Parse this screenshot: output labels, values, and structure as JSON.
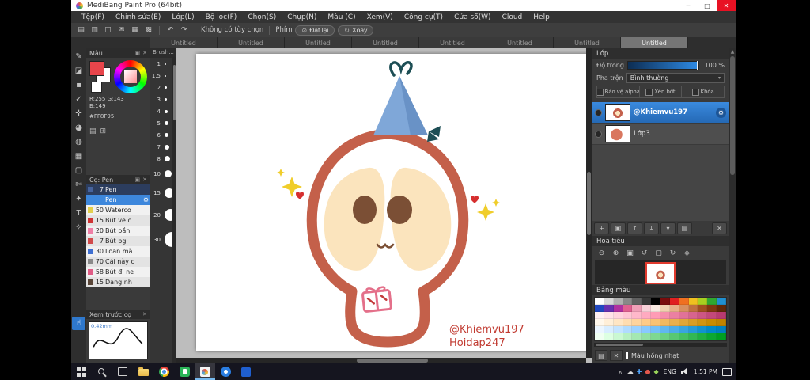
{
  "icons": {
    "gear": "⚙",
    "pin": "▣",
    "close": "✕",
    "caret_down": "▾",
    "scroll_up": "▲"
  },
  "window": {
    "title": "MediBang Paint Pro (64bit)",
    "controls": {
      "minimize": "─",
      "maximize": "□",
      "close": "✕"
    }
  },
  "menu": {
    "items": [
      "Tệp(F)",
      "Chỉnh sửa(E)",
      "Lớp(L)",
      "Bộ lọc(F)",
      "Chọn(S)",
      "Chụp(N)",
      "Màu (C)",
      "Xem(V)",
      "Công cụ(T)",
      "Cửa sổ(W)",
      "Cloud",
      "Help"
    ]
  },
  "toolbar": {
    "icons": [
      {
        "name": "new-canvas-icon",
        "glyph": "▤"
      },
      {
        "name": "open-file-icon",
        "glyph": "▥"
      },
      {
        "name": "save-icon",
        "glyph": "◫"
      },
      {
        "name": "export-icon",
        "glyph": "✉"
      },
      {
        "name": "grid-view-icon",
        "glyph": "▦"
      },
      {
        "name": "snap-settings-icon",
        "glyph": "▩"
      }
    ],
    "undo": "↶",
    "redo": "↷",
    "no_option_label": "Không có tùy chọn",
    "key_label": "Phím",
    "reset_icon": "⊘",
    "reset_button": "Đặt lại",
    "rotate_icon": "↻",
    "rotate_button": "Xoay"
  },
  "tabs": {
    "items": [
      "Untitled",
      "Untitled",
      "Untitled",
      "Untitled",
      "Untitled",
      "Untitled",
      "Untitled",
      "Untitled"
    ],
    "active_index": 7
  },
  "tools": [
    {
      "name": "brush-tool",
      "glyph": "✎"
    },
    {
      "name": "eraser-tool",
      "glyph": "◪"
    },
    {
      "name": "pen-tool",
      "glyph": "▪"
    },
    {
      "name": "smudge-tool",
      "glyph": "✓"
    },
    {
      "name": "move-tool",
      "glyph": "✛"
    },
    {
      "name": "fill-tool",
      "glyph": "◕"
    },
    {
      "name": "bucket-tool",
      "glyph": "◍"
    },
    {
      "name": "gradient-tool",
      "glyph": "▦"
    },
    {
      "name": "select-tool",
      "glyph": "▢"
    },
    {
      "name": "lasso-tool",
      "glyph": "✄"
    },
    {
      "name": "wand-tool",
      "glyph": "✦"
    },
    {
      "name": "text-tool",
      "glyph": "T"
    },
    {
      "name": "eyedropper-tool",
      "glyph": "✧"
    },
    {
      "name": "hand-tool",
      "glyph": "☝",
      "active": true
    }
  ],
  "color_panel": {
    "title": "Màu",
    "foreground": "#e8454b",
    "background": "#ffffff",
    "current": "#ffffff",
    "rgb_text": "R:255 G:143 B:149",
    "hex": "#FF8F95",
    "icons": [
      {
        "name": "palette-view-icon",
        "glyph": "▤"
      },
      {
        "name": "palette-add-icon",
        "glyph": "⊞"
      }
    ]
  },
  "brush_sizes": {
    "title": "Brush...",
    "items": [
      {
        "label": "1",
        "dot": 2
      },
      {
        "label": "1.5",
        "dot": 2
      },
      {
        "label": "2",
        "dot": 3
      },
      {
        "label": "3",
        "dot": 3
      },
      {
        "label": "4",
        "dot": 4
      },
      {
        "label": "5",
        "dot": 5
      },
      {
        "label": "6",
        "dot": 5
      },
      {
        "label": "7",
        "dot": 6
      },
      {
        "label": "8",
        "dot": 7
      },
      {
        "label": "10",
        "dot": 9
      },
      {
        "label": "15",
        "dot": 12
      },
      {
        "label": "20",
        "dot": 15
      },
      {
        "label": "30",
        "dot": 19
      }
    ]
  },
  "brushes": {
    "title": "Cọ: Pen",
    "items": [
      {
        "size": "7",
        "name": "Pen",
        "swatch": "#46639c"
      },
      {
        "size": "",
        "name": "Pen",
        "swatch": "",
        "selected": true
      },
      {
        "size": "50",
        "name": "Waterco",
        "swatch": "#e3cf4e"
      },
      {
        "size": "15",
        "name": "Bút vẽ c",
        "swatch": "#cf3333"
      },
      {
        "size": "20",
        "name": "Bút pần",
        "swatch": "#ef7fa6"
      },
      {
        "size": "7",
        "name": "Bút bg",
        "swatch": "#d14b4b"
      },
      {
        "size": "30",
        "name": "Loan mà",
        "swatch": "#3f6fd1"
      },
      {
        "size": "70",
        "name": "Cái này c",
        "swatch": "#8a8a8a"
      },
      {
        "size": "58",
        "name": "Bút đi ne",
        "swatch": "#e05d86"
      },
      {
        "size": "15",
        "name": "Dạng nh",
        "swatch": "#5a4638"
      }
    ]
  },
  "preview": {
    "title": "Xem trước cọ",
    "size_label": "0.42mm"
  },
  "layers_panel": {
    "title": "Lớp",
    "opacity_label": "Độ trong",
    "opacity_value": "100 %",
    "blend_label": "Pha trộn",
    "blend_value": "Bình thường",
    "checks": [
      {
        "label": "Bảo vệ alpha",
        "name": "alpha-protect-checkbox"
      },
      {
        "label": "Xén bớt",
        "name": "clipping-checkbox"
      },
      {
        "label": "Khóa",
        "name": "lock-checkbox"
      }
    ],
    "items": [
      {
        "name": "@Khiemvu197",
        "thumb": "character",
        "selected": true
      },
      {
        "name": "Lớp3",
        "thumb": "orange"
      }
    ],
    "buttons": [
      {
        "name": "add-layer-button",
        "glyph": "+"
      },
      {
        "name": "duplicate-layer-button",
        "glyph": "▣"
      },
      {
        "name": "layer-up-button",
        "glyph": "↑"
      },
      {
        "name": "layer-down-button",
        "glyph": "↓"
      },
      {
        "name": "layer-options-button",
        "glyph": "▾"
      },
      {
        "name": "layer-folder-button",
        "glyph": "▤"
      },
      {
        "name": "delete-layer-button",
        "glyph": "✕"
      }
    ]
  },
  "navigator": {
    "title": "Hoa tiêu",
    "zoom_icons": [
      {
        "name": "zoom-out-icon",
        "glyph": "⊖"
      },
      {
        "name": "zoom-in-icon",
        "glyph": "⊕"
      },
      {
        "name": "zoom-100-icon",
        "glyph": "▣"
      },
      {
        "name": "rotate-left-icon",
        "glyph": "↺"
      },
      {
        "name": "fit-screen-icon",
        "glyph": "▢"
      },
      {
        "name": "rotate-right-icon",
        "glyph": "↻"
      },
      {
        "name": "flip-icon",
        "glyph": "◈"
      }
    ]
  },
  "palette": {
    "title": "Bảng màu",
    "selected_name": "Màu hồng nhạt",
    "icons": [
      {
        "name": "palette-menu-icon",
        "glyph": "▤"
      },
      {
        "name": "palette-delete-icon",
        "glyph": "✕"
      }
    ],
    "colors": [
      "#ffffff",
      "#d8d8d8",
      "#b0b0b0",
      "#888888",
      "#606060",
      "#383838",
      "#000000",
      "#7a0c0c",
      "#e02020",
      "#f07020",
      "#f0c020",
      "#a8d020",
      "#30a830",
      "#2090d0",
      "#2048c0",
      "#6830b0",
      "#b030a0",
      "#e06090",
      "#f0a0b8",
      "#f8d0d8",
      "#f8e8e0",
      "#f0d0b0",
      "#e8b088",
      "#d89060",
      "#c07040",
      "#a05020",
      "#803810",
      "#602808",
      "#fff0f2",
      "#ffe2e8",
      "#ffd4de",
      "#ffc6d4",
      "#ffb8ca",
      "#ffaac0",
      "#ff9cb6",
      "#f58eac",
      "#eb80a2",
      "#e17298",
      "#d7648e",
      "#cd5684",
      "#c3487a",
      "#b93a70",
      "#fff8ec",
      "#ffefd8",
      "#ffe6c4",
      "#ffddb0",
      "#ffd49c",
      "#ffcb88",
      "#f8c274",
      "#f0b960",
      "#e8b04c",
      "#e0a738",
      "#d89e24",
      "#d09510",
      "#c88c00",
      "#c08300",
      "#ecf6ff",
      "#d8edff",
      "#c4e4ff",
      "#b0dbff",
      "#9cd2ff",
      "#88c9ff",
      "#74c0f8",
      "#60b7f0",
      "#4caee8",
      "#38a5e0",
      "#249cd8",
      "#1093d0",
      "#008ac8",
      "#0081c0",
      "#f0fff2",
      "#ddffe2",
      "#caf8d2",
      "#b7f0c2",
      "#a4e8b2",
      "#91e0a2",
      "#7ed892",
      "#6bd082",
      "#58c872",
      "#45c062",
      "#32b852",
      "#1fb042",
      "#0ca832",
      "#00a022"
    ]
  },
  "canvas": {
    "signature_line1": "@Khiemvu197",
    "signature_line2": "Hoidap247"
  },
  "taskbar": {
    "apps": [
      {
        "name": "start-button",
        "type": "start"
      },
      {
        "name": "search-button",
        "type": "search"
      },
      {
        "name": "task-view-button",
        "type": "taskview"
      },
      {
        "name": "file-explorer-icon",
        "type": "folder"
      },
      {
        "name": "chrome-icon",
        "type": "chrome"
      },
      {
        "name": "paint-app-icon",
        "type": "greenapp"
      },
      {
        "name": "medibang-taskbar-icon",
        "type": "medibang",
        "active": true
      },
      {
        "name": "chat-app-icon",
        "type": "bluecircle"
      },
      {
        "name": "browser-app-icon",
        "type": "bluesquare"
      }
    ],
    "tray_icons": [
      {
        "name": "cloud-tray-icon",
        "glyph": "☁",
        "color": "#d8d8d8"
      },
      {
        "name": "antivirus-tray-icon",
        "glyph": "✚",
        "color": "#52a8ff"
      },
      {
        "name": "update-tray-icon",
        "glyph": "●",
        "color": "#e2574c"
      },
      {
        "name": "graphics-tray-icon",
        "glyph": "◆",
        "color": "#9ad55a"
      }
    ],
    "chevron": "∧",
    "lang": "ENG",
    "time": "1:51 PM"
  }
}
